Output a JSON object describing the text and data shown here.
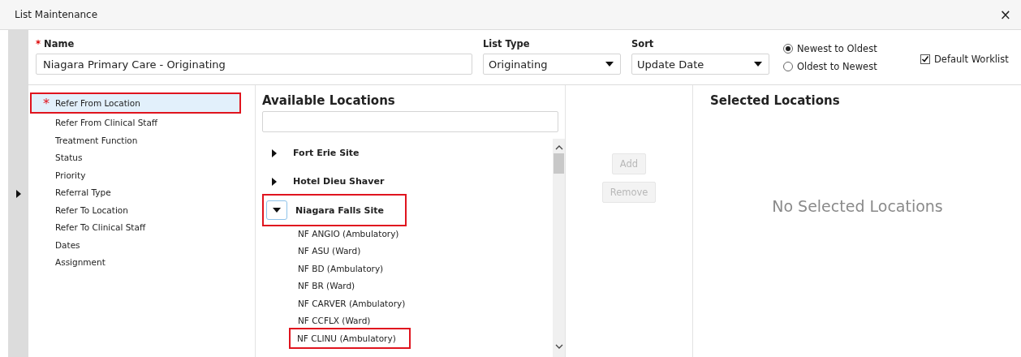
{
  "window": {
    "title": "List Maintenance",
    "close": "×"
  },
  "form": {
    "name": {
      "label": "Name",
      "required_mark": "*",
      "value": "Niagara Primary Care - Originating"
    },
    "list_type": {
      "label": "List Type",
      "value": "Originating"
    },
    "sort": {
      "label": "Sort",
      "value": "Update Date"
    },
    "order": [
      {
        "label": "Newest to Oldest",
        "selected": true
      },
      {
        "label": "Oldest to Newest",
        "selected": false
      }
    ],
    "default_worklist": {
      "label": "Default Worklist",
      "checked": true
    }
  },
  "criteria": [
    {
      "label": "Refer From Location",
      "required_mark": "*",
      "selected": true,
      "highlighted": true
    },
    {
      "label": "Refer From Clinical Staff",
      "selected": false,
      "highlighted": false
    },
    {
      "label": "Treatment Function",
      "selected": false,
      "highlighted": false
    },
    {
      "label": "Status",
      "selected": false,
      "highlighted": false
    },
    {
      "label": "Priority",
      "selected": false,
      "highlighted": false
    },
    {
      "label": "Referral Type",
      "selected": false,
      "highlighted": false
    },
    {
      "label": "Refer To Location",
      "selected": false,
      "highlighted": false
    },
    {
      "label": "Refer To Clinical Staff",
      "selected": false,
      "highlighted": false
    },
    {
      "label": "Dates",
      "selected": false,
      "highlighted": false
    },
    {
      "label": "Assignment",
      "selected": false,
      "highlighted": false
    }
  ],
  "available": {
    "title": "Available Locations",
    "tree": [
      {
        "label": "Fort Erie Site",
        "expanded": false,
        "highlighted": false
      },
      {
        "label": "Hotel Dieu Shaver",
        "expanded": false,
        "highlighted": false
      },
      {
        "label": "Niagara Falls Site",
        "expanded": true,
        "highlighted": true,
        "children": [
          {
            "label": "NF ANGIO (Ambulatory)",
            "highlighted": false
          },
          {
            "label": "NF ASU (Ward)",
            "highlighted": false
          },
          {
            "label": "NF BD (Ambulatory)",
            "highlighted": false
          },
          {
            "label": "NF BR (Ward)",
            "highlighted": false
          },
          {
            "label": "NF CARVER (Ambulatory)",
            "highlighted": false
          },
          {
            "label": "NF CCFLX (Ward)",
            "highlighted": false
          },
          {
            "label": "NF CLINU (Ambulatory)",
            "highlighted": true
          }
        ]
      }
    ]
  },
  "actions": [
    {
      "label": "Add",
      "disabled": true
    },
    {
      "label": "Remove",
      "disabled": true
    }
  ],
  "selected": {
    "title": "Selected Locations",
    "empty_text": "No Selected Locations"
  }
}
